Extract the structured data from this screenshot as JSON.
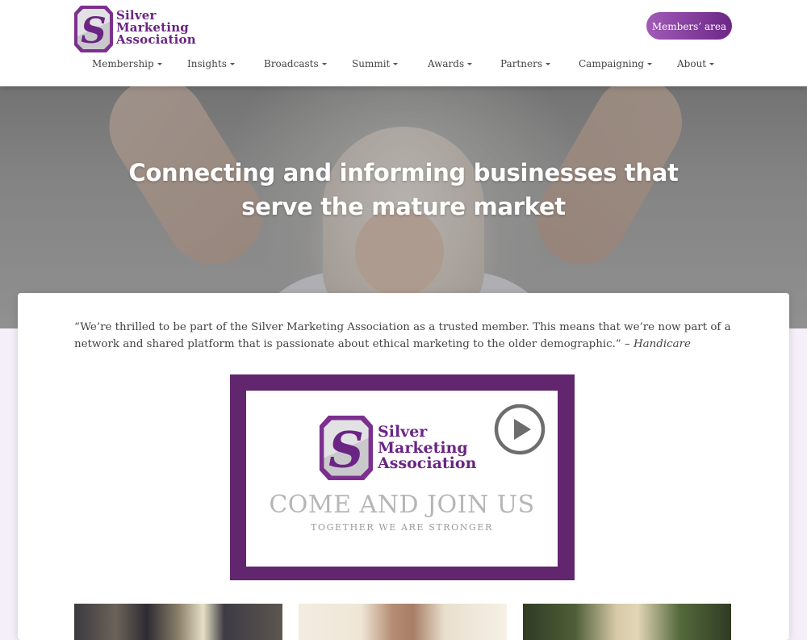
{
  "header": {
    "logo": {
      "line1": "Silver",
      "line2": "Marketing",
      "line3": "Association"
    },
    "members_button": "Members’ area"
  },
  "nav": {
    "items": [
      {
        "label": "Membership"
      },
      {
        "label": "Insights"
      },
      {
        "label": "Broadcasts"
      },
      {
        "label": "Summit"
      },
      {
        "label": "Awards"
      },
      {
        "label": "Partners"
      },
      {
        "label": "Campaigning"
      },
      {
        "label": "About"
      }
    ]
  },
  "hero": {
    "title_line1": "Connecting and informing businesses that",
    "title_line2": "serve the mature market"
  },
  "testimonial": {
    "quote": "“We’re thrilled to be part of the Silver Marketing Association as a trusted member. This means that we’re now part of a network and shared platform that is passionate about ethical marketing to the older demographic.” – ",
    "author": "Handicare"
  },
  "video": {
    "logo": {
      "line1": "Silver",
      "line2": "Marketing",
      "line3": "Association"
    },
    "headline": "COME AND JOIN US",
    "tagline": "TOGETHER WE ARE STRONGER",
    "icon": "play-icon"
  },
  "colors": {
    "brand_purple": "#6a2584",
    "video_frame": "#62266e",
    "button_gradient_start": "#a25ab8",
    "button_gradient_end": "#6b2786"
  }
}
